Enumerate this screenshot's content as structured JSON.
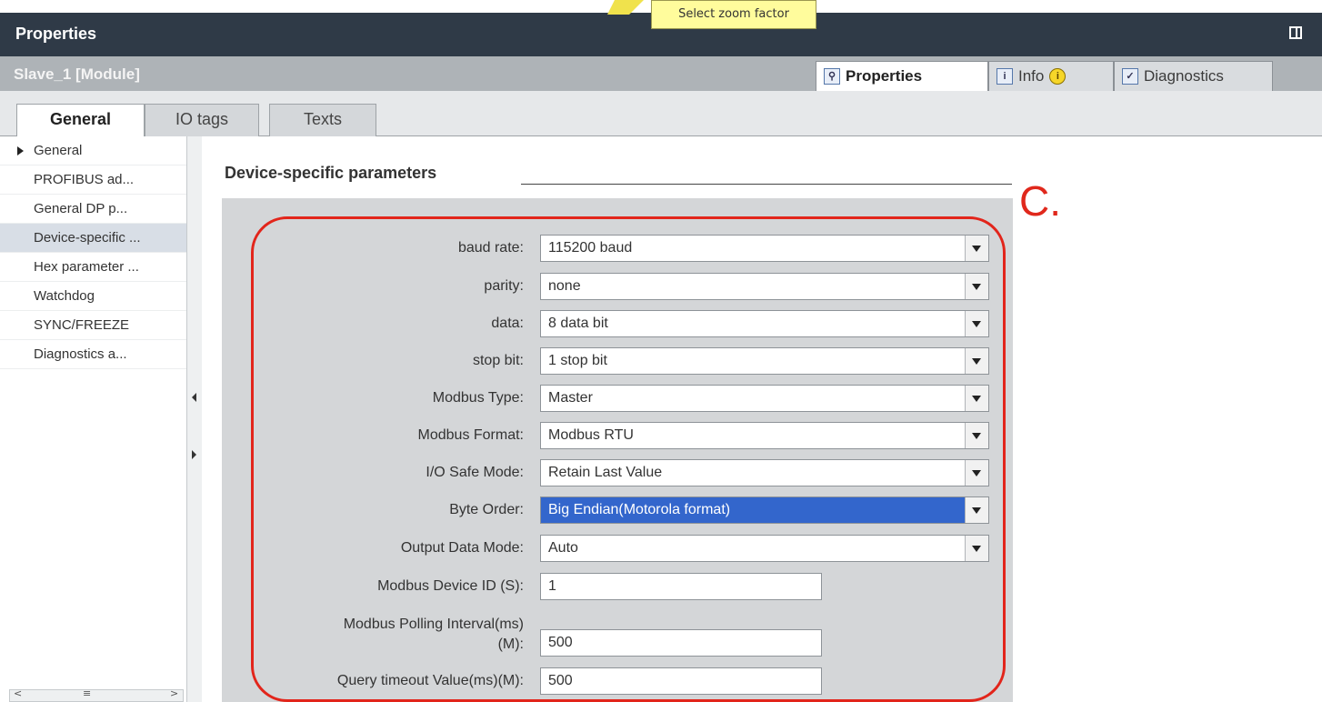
{
  "tooltip": "Select zoom factor",
  "header": {
    "title": "Properties"
  },
  "subheader": {
    "title": "Slave_1 [Module]"
  },
  "inspector_tabs": {
    "properties": "Properties",
    "info": "Info",
    "diagnostics": "Diagnostics"
  },
  "tabs": {
    "general": "General",
    "io_tags": "IO tags",
    "texts": "Texts"
  },
  "nav": {
    "items": [
      "General",
      "PROFIBUS ad...",
      "General DP p...",
      "Device-specific ...",
      "Hex parameter ...",
      "Watchdog",
      "SYNC/FREEZE",
      "Diagnostics a..."
    ]
  },
  "section": {
    "title": "Device-specific parameters"
  },
  "annotation": "C.",
  "params": {
    "baud_rate": {
      "label": "baud rate:",
      "value": "115200 baud"
    },
    "parity": {
      "label": "parity:",
      "value": "none"
    },
    "data": {
      "label": "data:",
      "value": "8 data bit"
    },
    "stop_bit": {
      "label": "stop bit:",
      "value": "1 stop bit"
    },
    "modbus_type": {
      "label": "Modbus Type:",
      "value": "Master"
    },
    "modbus_format": {
      "label": "Modbus Format:",
      "value": "Modbus RTU"
    },
    "io_safe_mode": {
      "label": "I/O Safe Mode:",
      "value": "Retain Last Value"
    },
    "byte_order": {
      "label": "Byte Order:",
      "value": "Big Endian(Motorola  format)"
    },
    "output_data_mode": {
      "label": "Output Data Mode:",
      "value": "Auto"
    },
    "modbus_device_id": {
      "label": "Modbus Device ID (S):",
      "value": "1"
    },
    "polling_interval": {
      "label_line1": "Modbus Polling Interval(ms)",
      "label_line2": "(M):",
      "value": "500"
    },
    "query_timeout": {
      "label": "Query timeout Value(ms)(M):",
      "value": "500"
    }
  },
  "colors": {
    "header_bg": "#2f3a47",
    "annotation_red": "#e2251b",
    "highlight_blue": "#3366cc"
  }
}
